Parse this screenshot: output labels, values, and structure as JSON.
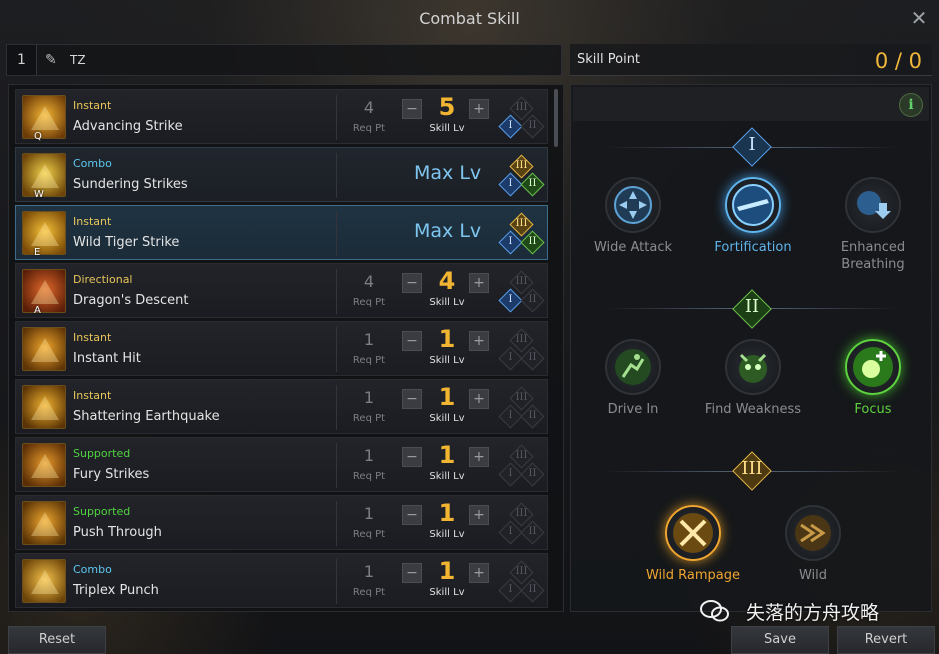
{
  "window": {
    "title": "Combat Skill"
  },
  "preset": {
    "number": "1",
    "name": "TZ"
  },
  "skill_point": {
    "label": "Skill Point",
    "value": "0 / 0"
  },
  "colors": {
    "instant": "#e6c55a",
    "combo": "#5ec8ef",
    "directional": "#e6c55a",
    "supported": "#4fd23f",
    "level": "#f2b531",
    "maxlv": "#7ec6ef"
  },
  "skills": [
    {
      "hotkey": "Q",
      "type": "Instant",
      "type_color": "#e6c55a",
      "name": "Advancing Strike",
      "req_pt": "4",
      "req_label": "Req Pt",
      "level": "5",
      "lv_label": "Skill Lv",
      "max": false,
      "tripods": [
        "off",
        "blue",
        "off"
      ]
    },
    {
      "hotkey": "W",
      "type": "Combo",
      "type_color": "#5ec8ef",
      "name": "Sundering Strikes",
      "max_label": "Max Lv",
      "max": true,
      "tripods": [
        "gold",
        "blue",
        "green"
      ]
    },
    {
      "hotkey": "E",
      "type": "Instant",
      "type_color": "#e6c55a",
      "name": "Wild Tiger Strike",
      "max_label": "Max Lv",
      "max": true,
      "tripods": [
        "gold",
        "blue",
        "green"
      ]
    },
    {
      "hotkey": "A",
      "type": "Directional",
      "type_color": "#e6c55a",
      "name": "Dragon's Descent",
      "req_pt": "4",
      "req_label": "Req Pt",
      "level": "4",
      "lv_label": "Skill Lv",
      "max": false,
      "tripods": [
        "off",
        "blue",
        "off"
      ]
    },
    {
      "hotkey": "",
      "type": "Instant",
      "type_color": "#e6c55a",
      "name": "Instant Hit",
      "req_pt": "1",
      "req_label": "Req Pt",
      "level": "1",
      "lv_label": "Skill Lv",
      "max": false,
      "tripods": [
        "off",
        "off",
        "off"
      ]
    },
    {
      "hotkey": "",
      "type": "Instant",
      "type_color": "#e6c55a",
      "name": "Shattering Earthquake",
      "req_pt": "1",
      "req_label": "Req Pt",
      "level": "1",
      "lv_label": "Skill Lv",
      "max": false,
      "tripods": [
        "off",
        "off",
        "off"
      ]
    },
    {
      "hotkey": "",
      "type": "Supported",
      "type_color": "#4fd23f",
      "name": "Fury Strikes",
      "req_pt": "1",
      "req_label": "Req Pt",
      "level": "1",
      "lv_label": "Skill Lv",
      "max": false,
      "tripods": [
        "off",
        "off",
        "off"
      ]
    },
    {
      "hotkey": "",
      "type": "Supported",
      "type_color": "#4fd23f",
      "name": "Push Through",
      "req_pt": "1",
      "req_label": "Req Pt",
      "level": "1",
      "lv_label": "Skill Lv",
      "max": false,
      "tripods": [
        "off",
        "off",
        "off"
      ]
    },
    {
      "hotkey": "",
      "type": "Combo",
      "type_color": "#5ec8ef",
      "name": "Triplex Punch",
      "req_pt": "1",
      "req_label": "Req Pt",
      "level": "1",
      "lv_label": "Skill Lv",
      "max": false,
      "tripods": [
        "off",
        "off",
        "off"
      ]
    }
  ],
  "tripod_labels": {
    "tier1": "I",
    "tier2": "II",
    "tier3": "III"
  },
  "tripod_tiers": {
    "tier1": [
      {
        "label": "Wide Attack",
        "state": "inactive",
        "color": "#8a8c90",
        "icon": "wide-attack-icon"
      },
      {
        "label": "Fortification",
        "state": "selected",
        "color": "#5fb4ec",
        "icon": "fortification-icon"
      },
      {
        "label": "Enhanced Breathing",
        "state": "inactive",
        "color": "#8a8c90",
        "icon": "enhanced-breathing-icon"
      }
    ],
    "tier2": [
      {
        "label": "Drive In",
        "state": "inactive",
        "color": "#8a8c90",
        "icon": "drive-in-icon"
      },
      {
        "label": "Find Weakness",
        "state": "inactive",
        "color": "#8a8c90",
        "icon": "find-weakness-icon"
      },
      {
        "label": "Focus",
        "state": "selected",
        "color": "#5fd23f",
        "icon": "focus-icon"
      }
    ],
    "tier3": [
      {
        "label": "Wild Rampage",
        "state": "selected",
        "color": "#f0a531",
        "icon": "wild-rampage-icon"
      },
      {
        "label": "Wild",
        "state": "inactive",
        "color": "#8a8c90",
        "icon": "wild-icon"
      }
    ]
  },
  "buttons": {
    "reset": "Reset",
    "save": "Save",
    "revert": "Revert"
  },
  "watermark": {
    "text": "失落的方舟攻略"
  }
}
